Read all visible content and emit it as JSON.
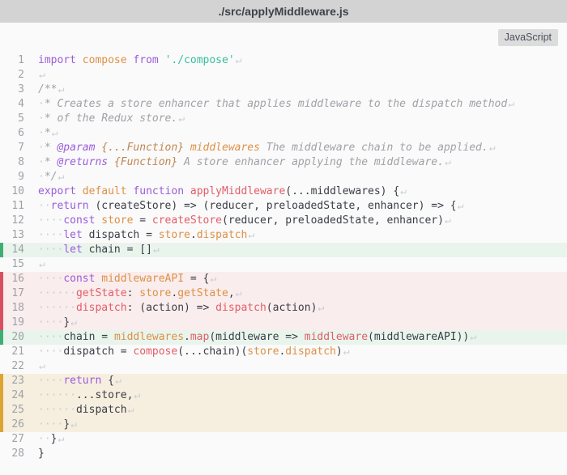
{
  "window": {
    "title": "./src/applyMiddleware.js",
    "language_badge": "JavaScript"
  },
  "theme": {
    "pageBg": "#fafafa",
    "titlebarBg": "#d3d3d3",
    "titleText": "#3d424b",
    "badgeBg": "#dcdcdc",
    "badgeText": "#4b515b",
    "lineNum": "#9ea2a8",
    "kw": "#9a5cd9",
    "id": "#dd9046",
    "fn": "#e25d68",
    "str": "#38bd9c",
    "cm": "#a0a1a7",
    "ty": "#c08552",
    "tx": "#3a3e46",
    "ws": "#c9ced6",
    "greenBg": "#e9f4ec",
    "greenBar": "#3fae73",
    "redBg": "#faeded",
    "redBar": "#d94f5f",
    "orangeBg": "#f6eedf",
    "orangeBar": "#dda432"
  },
  "editor": {
    "eol_marker": "↵",
    "lines": [
      {
        "n": 1,
        "hl": "",
        "eol": true,
        "segs": [
          [
            "kw",
            "import"
          ],
          [
            "tx",
            " "
          ],
          [
            "id",
            "compose"
          ],
          [
            "tx",
            " "
          ],
          [
            "kw",
            "from"
          ],
          [
            "tx",
            " "
          ],
          [
            "str",
            "'./compose'"
          ]
        ]
      },
      {
        "n": 2,
        "hl": "",
        "eol": true,
        "segs": []
      },
      {
        "n": 3,
        "hl": "",
        "eol": true,
        "segs": [
          [
            "cm",
            "/**"
          ]
        ]
      },
      {
        "n": 4,
        "hl": "",
        "eol": true,
        "segs": [
          [
            "ws",
            "·"
          ],
          [
            "cm",
            "* Creates a store enhancer that applies middleware to the dispatch method"
          ]
        ]
      },
      {
        "n": 5,
        "hl": "",
        "eol": true,
        "segs": [
          [
            "ws",
            "·"
          ],
          [
            "cm",
            "* of the Redux store."
          ]
        ]
      },
      {
        "n": 6,
        "hl": "",
        "eol": true,
        "segs": [
          [
            "ws",
            "·"
          ],
          [
            "cm",
            "*"
          ]
        ]
      },
      {
        "n": 7,
        "hl": "",
        "eol": true,
        "segs": [
          [
            "ws",
            "·"
          ],
          [
            "cm",
            "* "
          ],
          [
            "tg",
            "@param"
          ],
          [
            "cm",
            " "
          ],
          [
            "ty",
            "{...Function}"
          ],
          [
            "cm",
            " "
          ],
          [
            "pn",
            "middlewares"
          ],
          [
            "cm",
            " The middleware chain to be applied."
          ]
        ]
      },
      {
        "n": 8,
        "hl": "",
        "eol": true,
        "segs": [
          [
            "ws",
            "·"
          ],
          [
            "cm",
            "* "
          ],
          [
            "tg",
            "@returns"
          ],
          [
            "cm",
            " "
          ],
          [
            "ty",
            "{Function}"
          ],
          [
            "cm",
            " A store enhancer applying the middleware."
          ]
        ]
      },
      {
        "n": 9,
        "hl": "",
        "eol": true,
        "segs": [
          [
            "ws",
            "·"
          ],
          [
            "cm",
            "*/"
          ]
        ]
      },
      {
        "n": 10,
        "hl": "",
        "eol": true,
        "segs": [
          [
            "kw",
            "export"
          ],
          [
            "tx",
            " "
          ],
          [
            "id",
            "default"
          ],
          [
            "tx",
            " "
          ],
          [
            "kw",
            "function"
          ],
          [
            "tx",
            " "
          ],
          [
            "fn",
            "applyMiddleware"
          ],
          [
            "tx",
            "(...middlewares) {"
          ]
        ]
      },
      {
        "n": 11,
        "hl": "",
        "eol": true,
        "segs": [
          [
            "ws",
            "··"
          ],
          [
            "kw",
            "return"
          ],
          [
            "tx",
            " (createStore) => (reducer, preloadedState, enhancer) => {"
          ]
        ]
      },
      {
        "n": 12,
        "hl": "",
        "eol": true,
        "segs": [
          [
            "ws",
            "····"
          ],
          [
            "kw",
            "const"
          ],
          [
            "tx",
            " "
          ],
          [
            "id",
            "store"
          ],
          [
            "tx",
            " = "
          ],
          [
            "fn",
            "createStore"
          ],
          [
            "tx",
            "(reducer, preloadedState, enhancer)"
          ]
        ]
      },
      {
        "n": 13,
        "hl": "",
        "eol": true,
        "segs": [
          [
            "ws",
            "····"
          ],
          [
            "kw",
            "let"
          ],
          [
            "tx",
            " dispatch = "
          ],
          [
            "id",
            "store"
          ],
          [
            "tx",
            "."
          ],
          [
            "id",
            "dispatch"
          ]
        ]
      },
      {
        "n": 14,
        "hl": "green",
        "bar": true,
        "eol": true,
        "segs": [
          [
            "ws",
            "····"
          ],
          [
            "kw",
            "let"
          ],
          [
            "tx",
            " chain = []"
          ]
        ]
      },
      {
        "n": 15,
        "hl": "",
        "eol": true,
        "segs": []
      },
      {
        "n": 16,
        "hl": "red",
        "bar": true,
        "eol": true,
        "segs": [
          [
            "ws",
            "····"
          ],
          [
            "kw",
            "const"
          ],
          [
            "tx",
            " "
          ],
          [
            "id",
            "middlewareAPI"
          ],
          [
            "tx",
            " = {"
          ]
        ]
      },
      {
        "n": 17,
        "hl": "red",
        "bar": true,
        "eol": true,
        "segs": [
          [
            "ws",
            "······"
          ],
          [
            "fn",
            "getState"
          ],
          [
            "tx",
            ": "
          ],
          [
            "id",
            "store"
          ],
          [
            "tx",
            "."
          ],
          [
            "id",
            "getState"
          ],
          [
            "tx",
            ","
          ]
        ]
      },
      {
        "n": 18,
        "hl": "red",
        "bar": true,
        "eol": true,
        "segs": [
          [
            "ws",
            "······"
          ],
          [
            "fn",
            "dispatch"
          ],
          [
            "tx",
            ": (action) => "
          ],
          [
            "fn",
            "dispatch"
          ],
          [
            "tx",
            "(action)"
          ]
        ]
      },
      {
        "n": 19,
        "hl": "red",
        "bar": true,
        "eol": true,
        "segs": [
          [
            "ws",
            "····"
          ],
          [
            "tx",
            "}"
          ]
        ]
      },
      {
        "n": 20,
        "hl": "green",
        "bar": true,
        "eol": true,
        "segs": [
          [
            "ws",
            "····"
          ],
          [
            "tx",
            "chain = "
          ],
          [
            "id",
            "middlewares"
          ],
          [
            "tx",
            "."
          ],
          [
            "fn",
            "map"
          ],
          [
            "tx",
            "(middleware => "
          ],
          [
            "fn",
            "middleware"
          ],
          [
            "tx",
            "(middlewareAPI))"
          ]
        ]
      },
      {
        "n": 21,
        "hl": "",
        "eol": true,
        "segs": [
          [
            "ws",
            "····"
          ],
          [
            "tx",
            "dispatch = "
          ],
          [
            "fn",
            "compose"
          ],
          [
            "tx",
            "(...chain)("
          ],
          [
            "id",
            "store"
          ],
          [
            "tx",
            "."
          ],
          [
            "id",
            "dispatch"
          ],
          [
            "tx",
            ")"
          ]
        ]
      },
      {
        "n": 22,
        "hl": "",
        "eol": true,
        "segs": []
      },
      {
        "n": 23,
        "hl": "orange",
        "bar": true,
        "eol": true,
        "segs": [
          [
            "ws",
            "····"
          ],
          [
            "kw",
            "return"
          ],
          [
            "tx",
            " {"
          ]
        ]
      },
      {
        "n": 24,
        "hl": "orange",
        "bar": true,
        "eol": true,
        "segs": [
          [
            "ws",
            "······"
          ],
          [
            "tx",
            "...store,"
          ]
        ]
      },
      {
        "n": 25,
        "hl": "orange",
        "bar": true,
        "eol": true,
        "segs": [
          [
            "ws",
            "······"
          ],
          [
            "tx",
            "dispatch"
          ]
        ]
      },
      {
        "n": 26,
        "hl": "orange",
        "bar": true,
        "eol": true,
        "segs": [
          [
            "ws",
            "····"
          ],
          [
            "tx",
            "}"
          ]
        ]
      },
      {
        "n": 27,
        "hl": "",
        "eol": true,
        "segs": [
          [
            "ws",
            "··"
          ],
          [
            "tx",
            "}"
          ]
        ]
      },
      {
        "n": 28,
        "hl": "",
        "eol": false,
        "segs": [
          [
            "tx",
            "}"
          ]
        ]
      }
    ]
  }
}
